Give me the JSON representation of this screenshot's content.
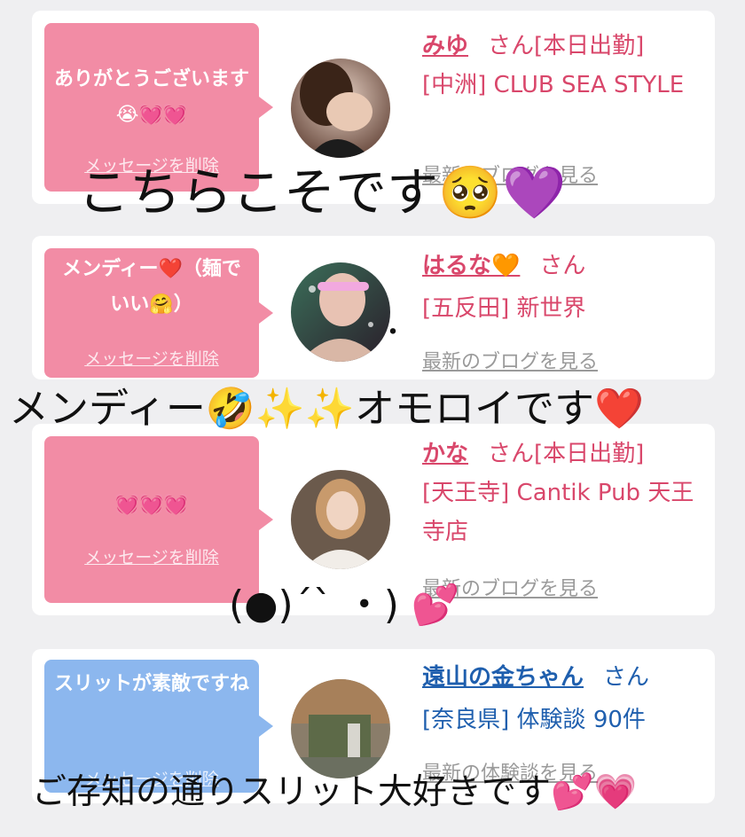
{
  "cards": [
    {
      "bubble_text": "ありがとうございます😭💓💓",
      "delete_label": "メッセージを削除",
      "name": "みゆ",
      "suffix": "さん[本日出勤]",
      "shop": "[中洲] CLUB SEA STYLE",
      "blog_link": "最新のブログを見る",
      "bubble_color": "#f28ca5",
      "text_color": "#d9476b"
    },
    {
      "bubble_text": "メンディー❤️（麺でいい🤗）",
      "delete_label": "メッセージを削除",
      "name": "はるな🧡",
      "suffix": "さん",
      "shop": "[五反田] 新世界",
      "blog_link": "最新のブログを見る",
      "bubble_color": "#f28ca5",
      "text_color": "#d9476b"
    },
    {
      "bubble_text": "💓💓💓",
      "delete_label": "メッセージを削除",
      "name": "かな",
      "suffix": "さん[本日出勤]",
      "shop": "[天王寺] Cantik Pub 天王寺店",
      "blog_link": "最新のブログを見る",
      "bubble_color": "#f28ca5",
      "text_color": "#d9476b"
    },
    {
      "bubble_text": "スリットが素敵ですね",
      "delete_label": "メッセージを削除",
      "name": "遠山の金ちゃん",
      "suffix": "さん",
      "shop": "[奈良県] 体験談 90件",
      "blog_link": "最新の体験談を見る",
      "bubble_color": "#8cb7ee",
      "text_color": "#1f5fae"
    }
  ],
  "overlays": {
    "caption1": "こちらこそです🥺💜",
    "dot": "・",
    "caption2": "メンディー🤣✨✨オモロイです❤️",
    "caption3": "(●)´` ・) 💕",
    "caption4": "ご存知の通りスリット大好きです💕💗"
  }
}
